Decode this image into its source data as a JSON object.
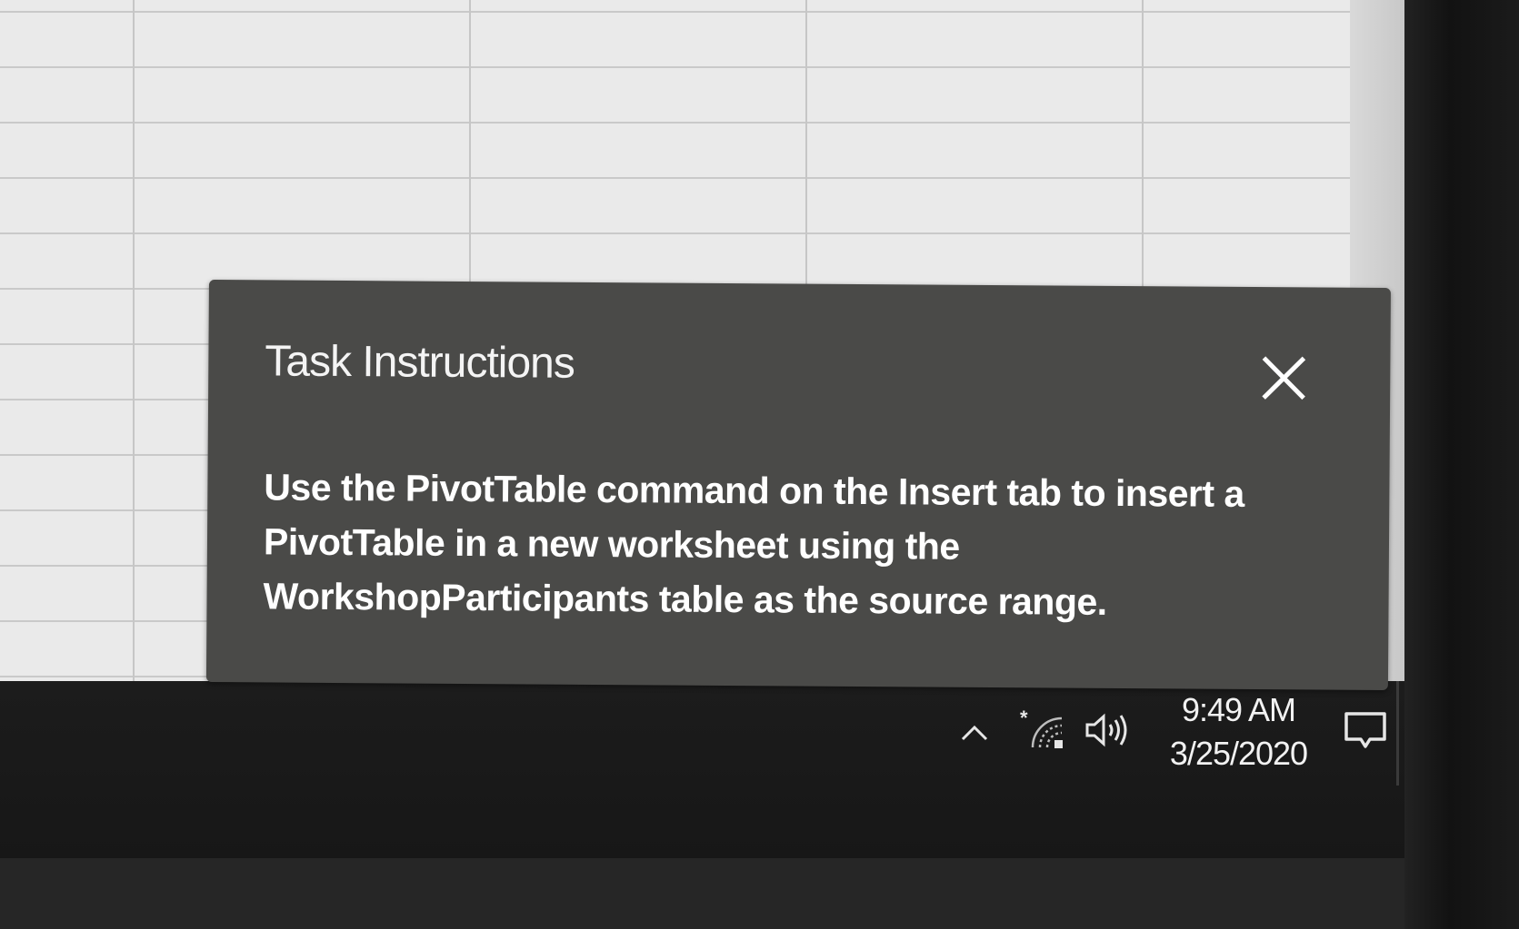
{
  "dialog": {
    "title": "Task Instructions",
    "close_icon": "close-icon",
    "body_lines": [
      "Use the PivotTable command on the Insert tab to insert a",
      "PivotTable in a new worksheet using the",
      "WorkshopParticipants table as the source range."
    ]
  },
  "taskbar": {
    "time": "9:49 AM",
    "date": "3/25/2020",
    "icons": [
      "chevron-up-icon",
      "bluetooth-icon",
      "wifi-icon",
      "volume-icon",
      "action-center-icon"
    ]
  },
  "colors": {
    "dialog_bg": "#4a4a48",
    "taskbar_bg": "#1c1c1c",
    "sheet_bg": "#eaeaea"
  }
}
